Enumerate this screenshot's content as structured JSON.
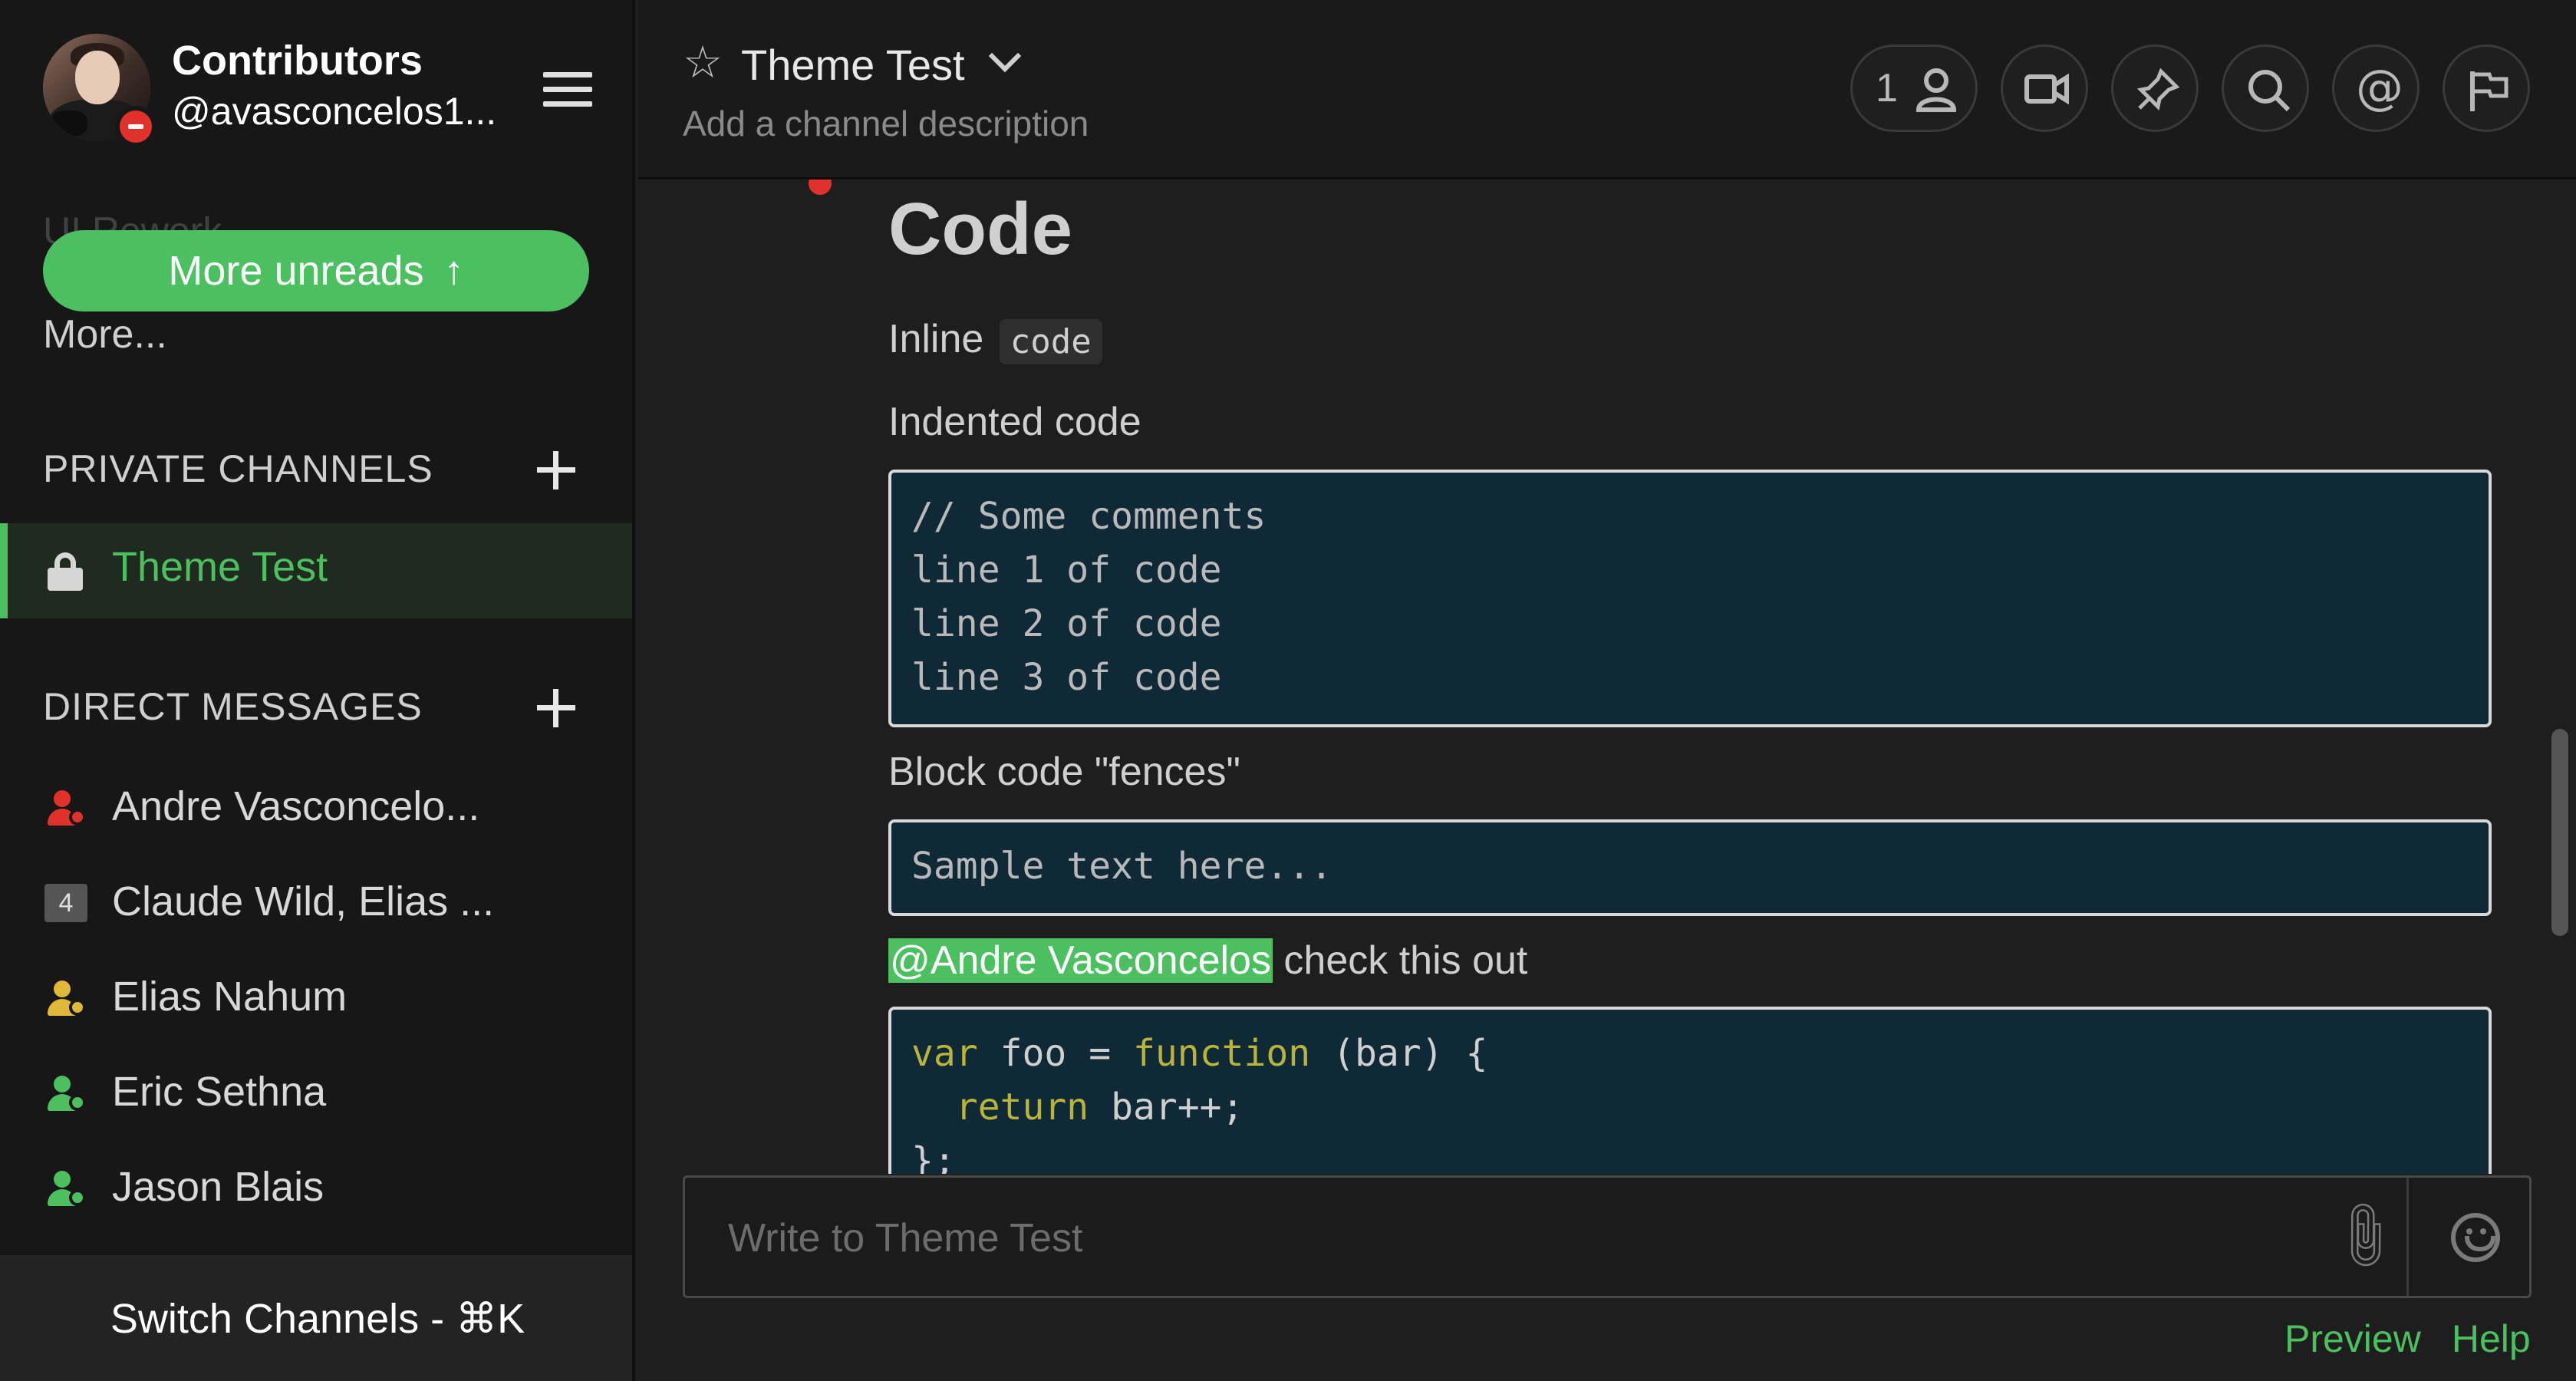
{
  "sidebar": {
    "team_name": "Contributors",
    "username": "@avasconcelos1...",
    "hidden_item": "UI Rework",
    "more_unreads": "More unreads",
    "more_link": "More...",
    "private_channels_header": "PRIVATE CHANNELS",
    "active_channel": "Theme Test",
    "direct_messages_header": "DIRECT MESSAGES",
    "dms": [
      {
        "label": "Andre Vasconcelo...",
        "status": "dnd",
        "color": "#e0322b"
      },
      {
        "label": "Claude Wild, Elias ...",
        "badge": "4"
      },
      {
        "label": "Elias Nahum",
        "status": "away",
        "color": "#e0b83a"
      },
      {
        "label": "Eric Sethna",
        "status": "online",
        "color": "#4cbf60"
      },
      {
        "label": "Jason Blais",
        "status": "online",
        "color": "#4cbf60"
      }
    ],
    "switch_channels": "Switch Channels - ⌘K"
  },
  "header": {
    "channel_name": "Theme Test",
    "description": "Add a channel description",
    "member_count": "1",
    "icons": [
      "member-icon",
      "video-icon",
      "pin-icon",
      "search-icon",
      "at-icon",
      "flag-icon"
    ]
  },
  "post": {
    "heading": "Code",
    "inline_label": "Inline",
    "inline_code": "code",
    "indented_label": "Indented code",
    "indented_lines": [
      "// Some comments",
      "line 1 of code",
      "line 2 of code",
      "line 3 of code"
    ],
    "fences_label": "Block code \"fences\"",
    "fences_text": "Sample text here...",
    "mention": "@Andre Vasconcelos",
    "mention_after": " check this out",
    "js_code": {
      "line1_kw1": "var",
      "line1_mid": " foo = ",
      "line1_kw2": "function",
      "line1_end": " (bar) {",
      "line2_kw": "return",
      "line2_end": " bar++;",
      "line3": "};"
    }
  },
  "composer": {
    "placeholder": "Write to Theme Test",
    "preview": "Preview",
    "help": "Help"
  },
  "colors": {
    "accent": "#4cbf60",
    "sidebar_bg": "#171717",
    "code_bg": "#0f2a36",
    "dnd": "#e0322b",
    "away": "#e0b83a"
  }
}
